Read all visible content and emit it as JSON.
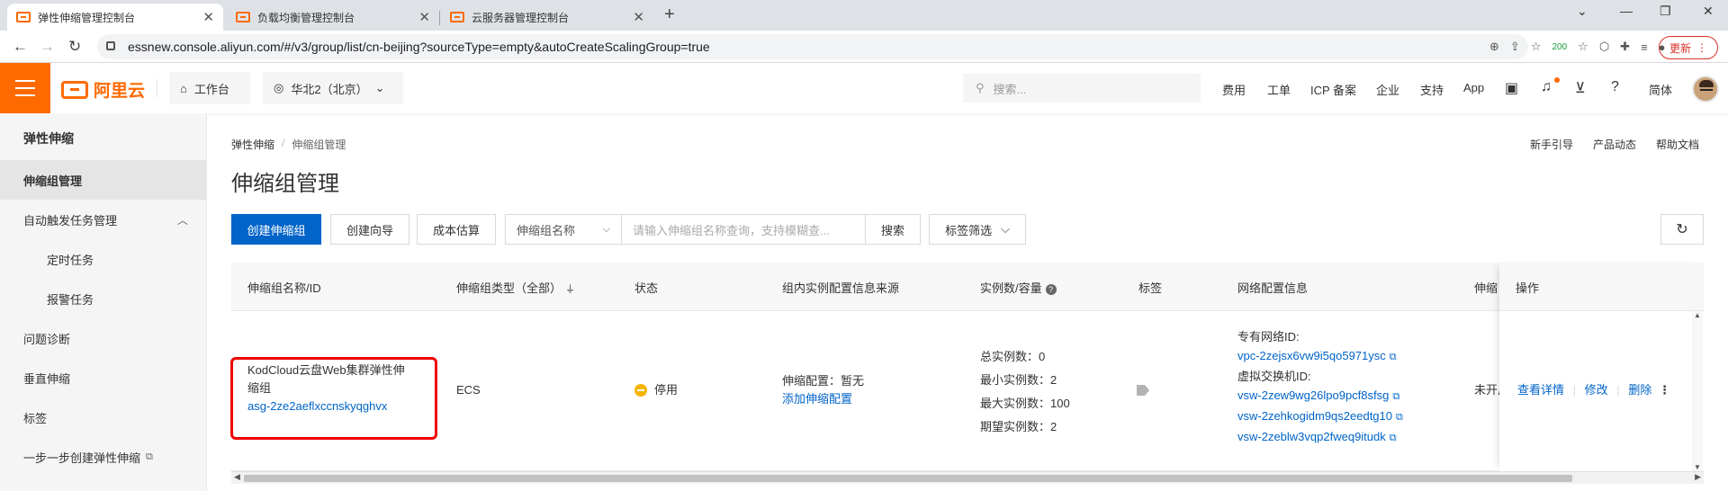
{
  "browser": {
    "tabs": [
      {
        "title": "弹性伸缩管理控制台",
        "active": true
      },
      {
        "title": "负载均衡管理控制台",
        "active": false
      },
      {
        "title": "云服务器管理控制台",
        "active": false
      }
    ],
    "url": "essnew.console.aliyun.com/#/v3/group/list/cn-beijing?sourceType=empty&autoCreateScalingGroup=true",
    "ext_badge": "200",
    "update_label": "更新"
  },
  "header": {
    "logo_text": "阿里云",
    "workbench": "工作台",
    "region": "华北2（北京）",
    "search_placeholder": "搜索...",
    "nav": [
      "费用",
      "工单",
      "ICP 备案",
      "企业",
      "支持",
      "App"
    ],
    "lang": "简体"
  },
  "sidebar": {
    "title": "弹性伸缩",
    "items": [
      {
        "label": "伸缩组管理",
        "active": true
      },
      {
        "label": "自动触发任务管理"
      },
      {
        "label": "定时任务"
      },
      {
        "label": "报警任务"
      },
      {
        "label": "问题诊断"
      },
      {
        "label": "垂直伸缩"
      },
      {
        "label": "标签"
      },
      {
        "label": "一步一步创建弹性伸缩"
      }
    ]
  },
  "breadcrumb": {
    "root": "弹性伸缩",
    "sep": "/",
    "current": "伸缩组管理"
  },
  "toplinks": [
    "新手引导",
    "产品动态",
    "帮助文档"
  ],
  "page_title": "伸缩组管理",
  "toolbar": {
    "create": "创建伸缩组",
    "wizard": "创建向导",
    "cost": "成本估算",
    "filter_select": "伸缩组名称",
    "search_placeholder": "请输入伸缩组名称查询，支持模糊查...",
    "search_btn": "搜索",
    "tag_filter": "标签筛选"
  },
  "table": {
    "columns": [
      "伸缩组名称/ID",
      "伸缩组类型（全部）",
      "状态",
      "组内实例配置信息来源",
      "实例数/容量",
      "标签",
      "网络配置信息",
      "伸缩",
      "操作"
    ],
    "rows": [
      {
        "name_line1": "KodCloud云盘Web集群弹性伸",
        "name_line2": "缩组",
        "id": "asg-2ze2aeflxccnskyqghvx",
        "type": "ECS",
        "status": "停用",
        "config_label": "伸缩配置：暂无",
        "config_link": "添加伸缩配置",
        "counts": [
          "总实例数：0",
          "最小实例数：2",
          "最大实例数：100",
          "期望实例数：2"
        ],
        "vpc_label": "专有网络ID:",
        "vpc_id": "vpc-2zejsx6vw9i5qo5971ysc",
        "vsw_label": "虚拟交换机ID:",
        "vsw_ids": [
          "vsw-2zew9wg26lpo9pcf8sfsg",
          "vsw-2zehkogidm9qs2eedtg10",
          "vsw-2zeblw3vqp2fweq9itudk"
        ],
        "scaling_trunc": "未开启",
        "actions": [
          "查看详情",
          "修改",
          "删除"
        ]
      }
    ]
  },
  "colors": {
    "brand": "#ff6a00",
    "primary": "#0064c8",
    "highlight": "#e00000",
    "status_stopped": "#f5b400"
  }
}
